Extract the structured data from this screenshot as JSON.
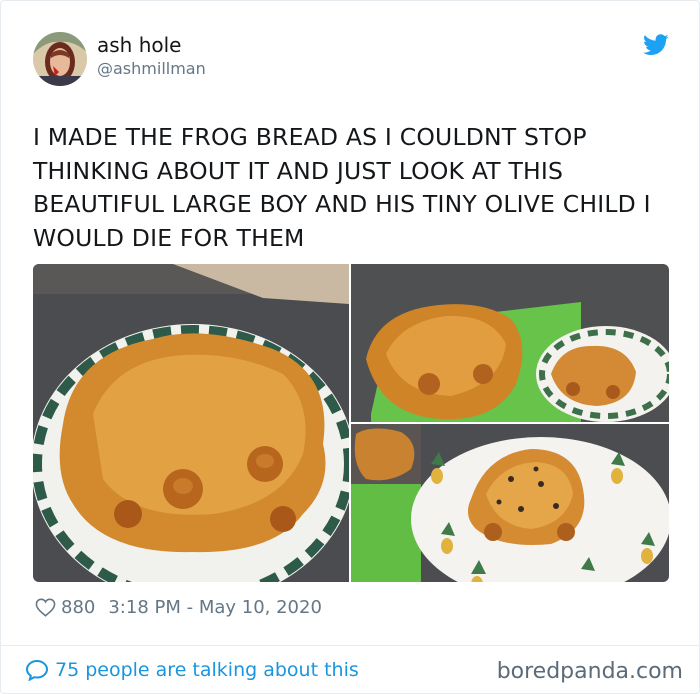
{
  "author": {
    "display_name": "ash hole",
    "handle": "@ashmillman",
    "avatar_icon": "profile-avatar"
  },
  "platform_icon": "twitter-bird-icon",
  "tweet": {
    "text": "I MADE THE FROG BREAD AS I COULDNT STOP THINKING ABOUT IT AND JUST LOOK AT THIS BEAUTIFUL LARGE BOY AND HIS TINY OLIVE CHILD I WOULD DIE FOR THEM"
  },
  "media": {
    "photos": [
      "frog-bread-large",
      "frog-bread-with-small",
      "small-frog-bread-olives"
    ]
  },
  "meta": {
    "likes": "880",
    "timestamp": "3:18 PM - May 10, 2020"
  },
  "footer": {
    "talking": "75 people are talking about this",
    "watermark": "boredpanda.com"
  },
  "colors": {
    "twitter_blue": "#1da1f2",
    "link_blue": "#1b95e0",
    "muted_text": "#657786",
    "divider": "#e6ecf0"
  }
}
